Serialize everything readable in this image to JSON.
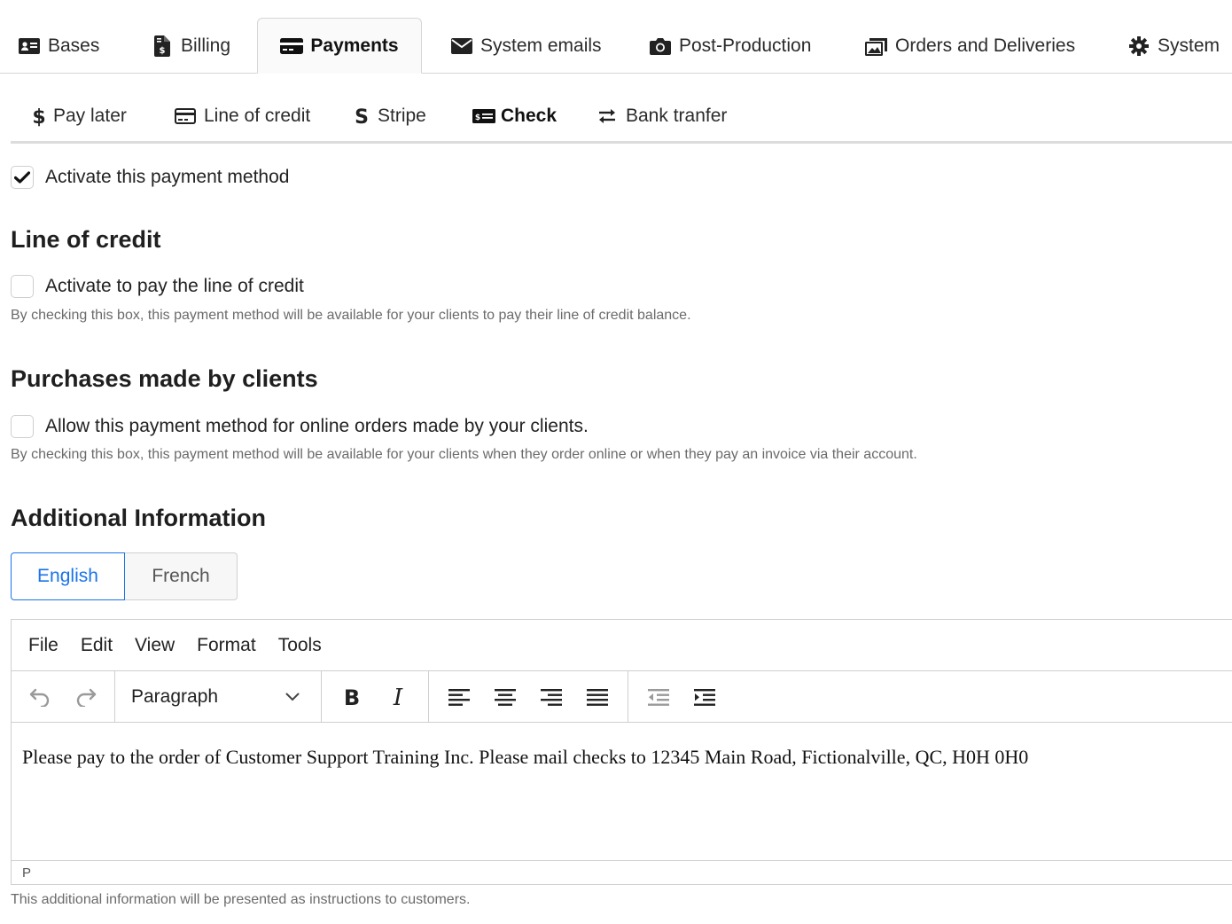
{
  "top_tabs": {
    "bases": "Bases",
    "billing": "Billing",
    "payments": "Payments",
    "system_emails": "System emails",
    "post_production": "Post-Production",
    "orders_deliveries": "Orders and Deliveries",
    "system": "System",
    "active": "Payments"
  },
  "sub_tabs": {
    "pay_later": "Pay later",
    "line_of_credit": "Line of credit",
    "stripe": "Stripe",
    "check": "Check",
    "bank_transfer": "Bank tranfer",
    "active": "Check"
  },
  "activate": {
    "label": "Activate this payment method",
    "checked": true
  },
  "line_of_credit_section": {
    "title": "Line of credit",
    "checkbox_label": "Activate to pay the line of credit",
    "checked": false,
    "help": "By checking this box, this payment method will be available for your clients to pay their line of credit balance."
  },
  "purchases_section": {
    "title": "Purchases made by clients",
    "checkbox_label": "Allow this payment method for online orders made by your clients.",
    "checked": false,
    "help": "By checking this box, this payment method will be available for your clients when they order online or when they pay an invoice via their account."
  },
  "additional_section": {
    "title": "Additional Information",
    "lang_english": "English",
    "lang_french": "French",
    "active_lang": "English",
    "help": "This additional information will be presented as instructions to customers."
  },
  "editor": {
    "menu": {
      "file": "File",
      "edit": "Edit",
      "view": "View",
      "format": "Format",
      "tools": "Tools"
    },
    "block_format": "Paragraph",
    "content": "Please pay to the order of Customer Support Training Inc.  Please mail checks to 12345 Main Road, Fictionalville, QC, H0H 0H0",
    "status_path": "P"
  },
  "colors": {
    "accent": "#1a73e8",
    "text": "#1f1f1f",
    "muted": "#6b6b6b",
    "border": "#cfcfcf"
  }
}
